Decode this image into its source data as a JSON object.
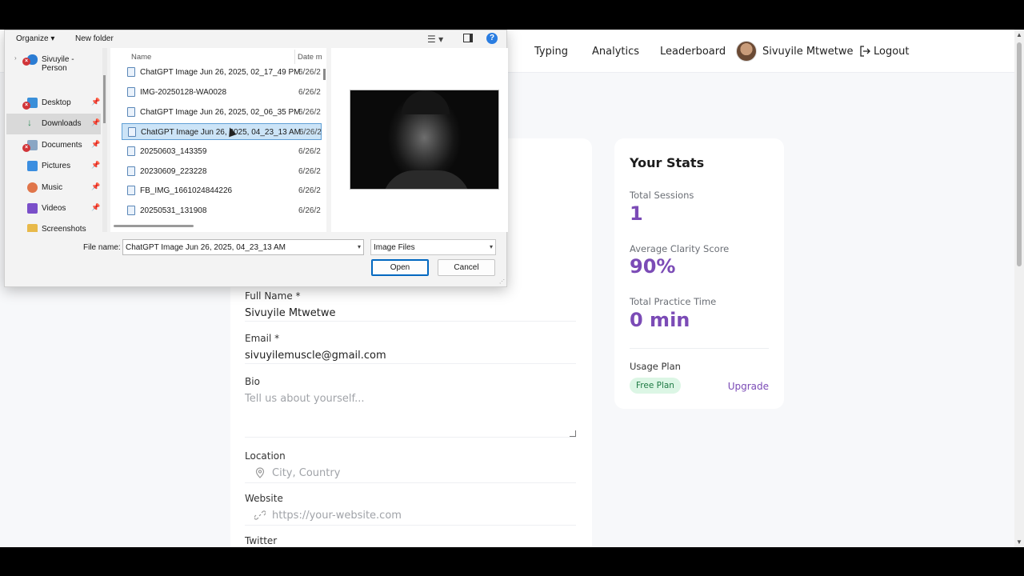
{
  "app": {
    "nav": {
      "links": [
        "Typing",
        "Analytics",
        "Leaderboard"
      ],
      "user_name": "Sivuyile Mtwetwe",
      "logout_label": "Logout"
    },
    "profile_form": {
      "full_name_label": "Full Name *",
      "full_name_value": "Sivuyile Mtwetwe",
      "email_label": "Email *",
      "email_value": "sivuyilemuscle@gmail.com",
      "bio_label": "Bio",
      "bio_placeholder": "Tell us about yourself...",
      "location_label": "Location",
      "location_placeholder": "City, Country",
      "website_label": "Website",
      "website_placeholder": "https://your-website.com",
      "twitter_label": "Twitter"
    },
    "stats": {
      "title": "Your Stats",
      "total_sessions_label": "Total Sessions",
      "total_sessions_value": "1",
      "avg_clarity_label": "Average Clarity Score",
      "avg_clarity_value": "90%",
      "practice_time_label": "Total Practice Time",
      "practice_time_value": "0 min",
      "usage_plan_label": "Usage Plan",
      "plan_badge": "Free Plan",
      "upgrade_label": "Upgrade"
    },
    "colors": {
      "accent": "#7b4bb6",
      "badge_bg": "#dcf6e5",
      "badge_fg": "#1f7a44"
    }
  },
  "file_dialog": {
    "toolbar": {
      "organize_label": "Organize ▾",
      "new_folder_label": "New folder"
    },
    "nav_items": [
      {
        "label": "Sivuyile - Person",
        "icon": "cloud-icon"
      },
      {
        "label": "Desktop",
        "icon": "desktop-icon"
      },
      {
        "label": "Downloads",
        "icon": "download-icon"
      },
      {
        "label": "Documents",
        "icon": "documents-icon"
      },
      {
        "label": "Pictures",
        "icon": "pictures-icon"
      },
      {
        "label": "Music",
        "icon": "music-icon"
      },
      {
        "label": "Videos",
        "icon": "videos-icon"
      },
      {
        "label": "Screenshots",
        "icon": "folder-icon"
      }
    ],
    "columns": {
      "name": "Name",
      "date": "Date m"
    },
    "files": [
      {
        "name": "ChatGPT Image Jun 26, 2025, 02_17_49 PM",
        "date": "6/26/2"
      },
      {
        "name": "IMG-20250128-WA0028",
        "date": "6/26/2"
      },
      {
        "name": "ChatGPT Image Jun 26, 2025, 02_06_35 PM",
        "date": "6/26/2"
      },
      {
        "name": "ChatGPT Image Jun 26, 2025, 04_23_13 AM",
        "date": "6/26/2",
        "selected": true
      },
      {
        "name": "20250603_143359",
        "date": "6/26/2"
      },
      {
        "name": "20230609_223228",
        "date": "6/26/2"
      },
      {
        "name": "FB_IMG_1661024844226",
        "date": "6/26/2"
      },
      {
        "name": "20250531_131908",
        "date": "6/26/2"
      }
    ],
    "file_name_label": "File name:",
    "file_name_value": "ChatGPT Image Jun 26, 2025, 04_23_13 AM",
    "file_type_value": "Image Files",
    "open_label": "Open",
    "cancel_label": "Cancel"
  }
}
